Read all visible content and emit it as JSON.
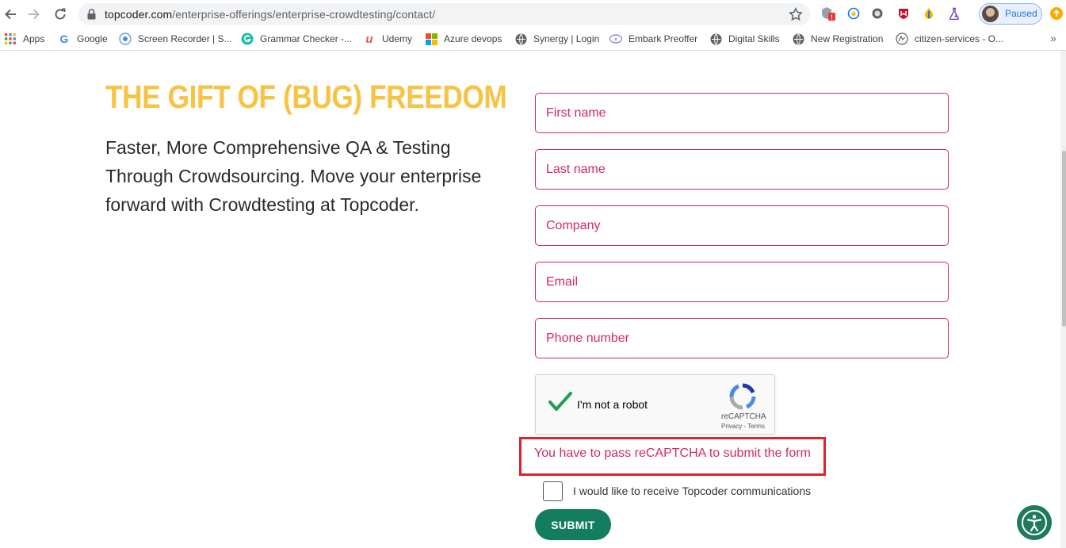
{
  "browser": {
    "url_host": "topcoder.com",
    "url_path": "/enterprise-offerings/enterprise-crowdtesting/contact/",
    "extensions": [
      {
        "name": "adblock-icon",
        "badge": "!"
      },
      {
        "name": "fire-icon"
      },
      {
        "name": "circle-icon"
      },
      {
        "name": "shield-icon"
      },
      {
        "name": "drop-icon"
      },
      {
        "name": "flask-icon"
      }
    ],
    "profile_label": "Paused",
    "colors": {
      "omnibox": "#f1f3f4",
      "profile": "#1a73e8",
      "update": "#f9ab00"
    }
  },
  "bookmarks": [
    {
      "label": "Apps",
      "icon": "apps-grid-icon"
    },
    {
      "label": "Google",
      "icon": "google-icon"
    },
    {
      "label": "Screen Recorder | S...",
      "icon": "recorder-icon"
    },
    {
      "label": "Grammar Checker -...",
      "icon": "grammarly-icon"
    },
    {
      "label": "Udemy",
      "icon": "udemy-icon"
    },
    {
      "label": "Azure devops",
      "icon": "microsoft-icon"
    },
    {
      "label": "Synergy | Login",
      "icon": "globe-icon"
    },
    {
      "label": "Embark Preoffer",
      "icon": "embark-icon"
    },
    {
      "label": "Digital Skills",
      "icon": "globe-icon"
    },
    {
      "label": "New Registration",
      "icon": "globe-icon"
    },
    {
      "label": "citizen-services - O...",
      "icon": "citizen-icon"
    }
  ],
  "bookmarks_more": "»",
  "hero": {
    "headline": "THE GIFT OF (BUG) FREEDOM",
    "intro": "Faster, More Comprehensive QA & Testing Through Crowdsourcing. Move your enterprise forward with Crowdtesting at Topcoder."
  },
  "form": {
    "first_name": {
      "placeholder": "First name",
      "value": ""
    },
    "last_name": {
      "placeholder": "Last name",
      "value": ""
    },
    "company": {
      "placeholder": "Company",
      "value": ""
    },
    "email": {
      "placeholder": "Email",
      "value": ""
    },
    "phone": {
      "placeholder": "Phone number",
      "value": ""
    },
    "captcha": {
      "label": "I'm not a robot",
      "checked": true,
      "brand": "reCAPTCHA",
      "terms": "Privacy - Terms"
    },
    "error": "You have to pass reCAPTCHA to submit the form",
    "opt_in": {
      "label": "I would like to receive Topcoder communications",
      "checked": false
    },
    "submit_label": "SUBMIT"
  },
  "colors": {
    "headline": "#f6c343",
    "field_accent": "#d6285e",
    "submit": "#137d60",
    "error_highlight": "#e0202a",
    "a11y_button": "#1e7a5b"
  }
}
